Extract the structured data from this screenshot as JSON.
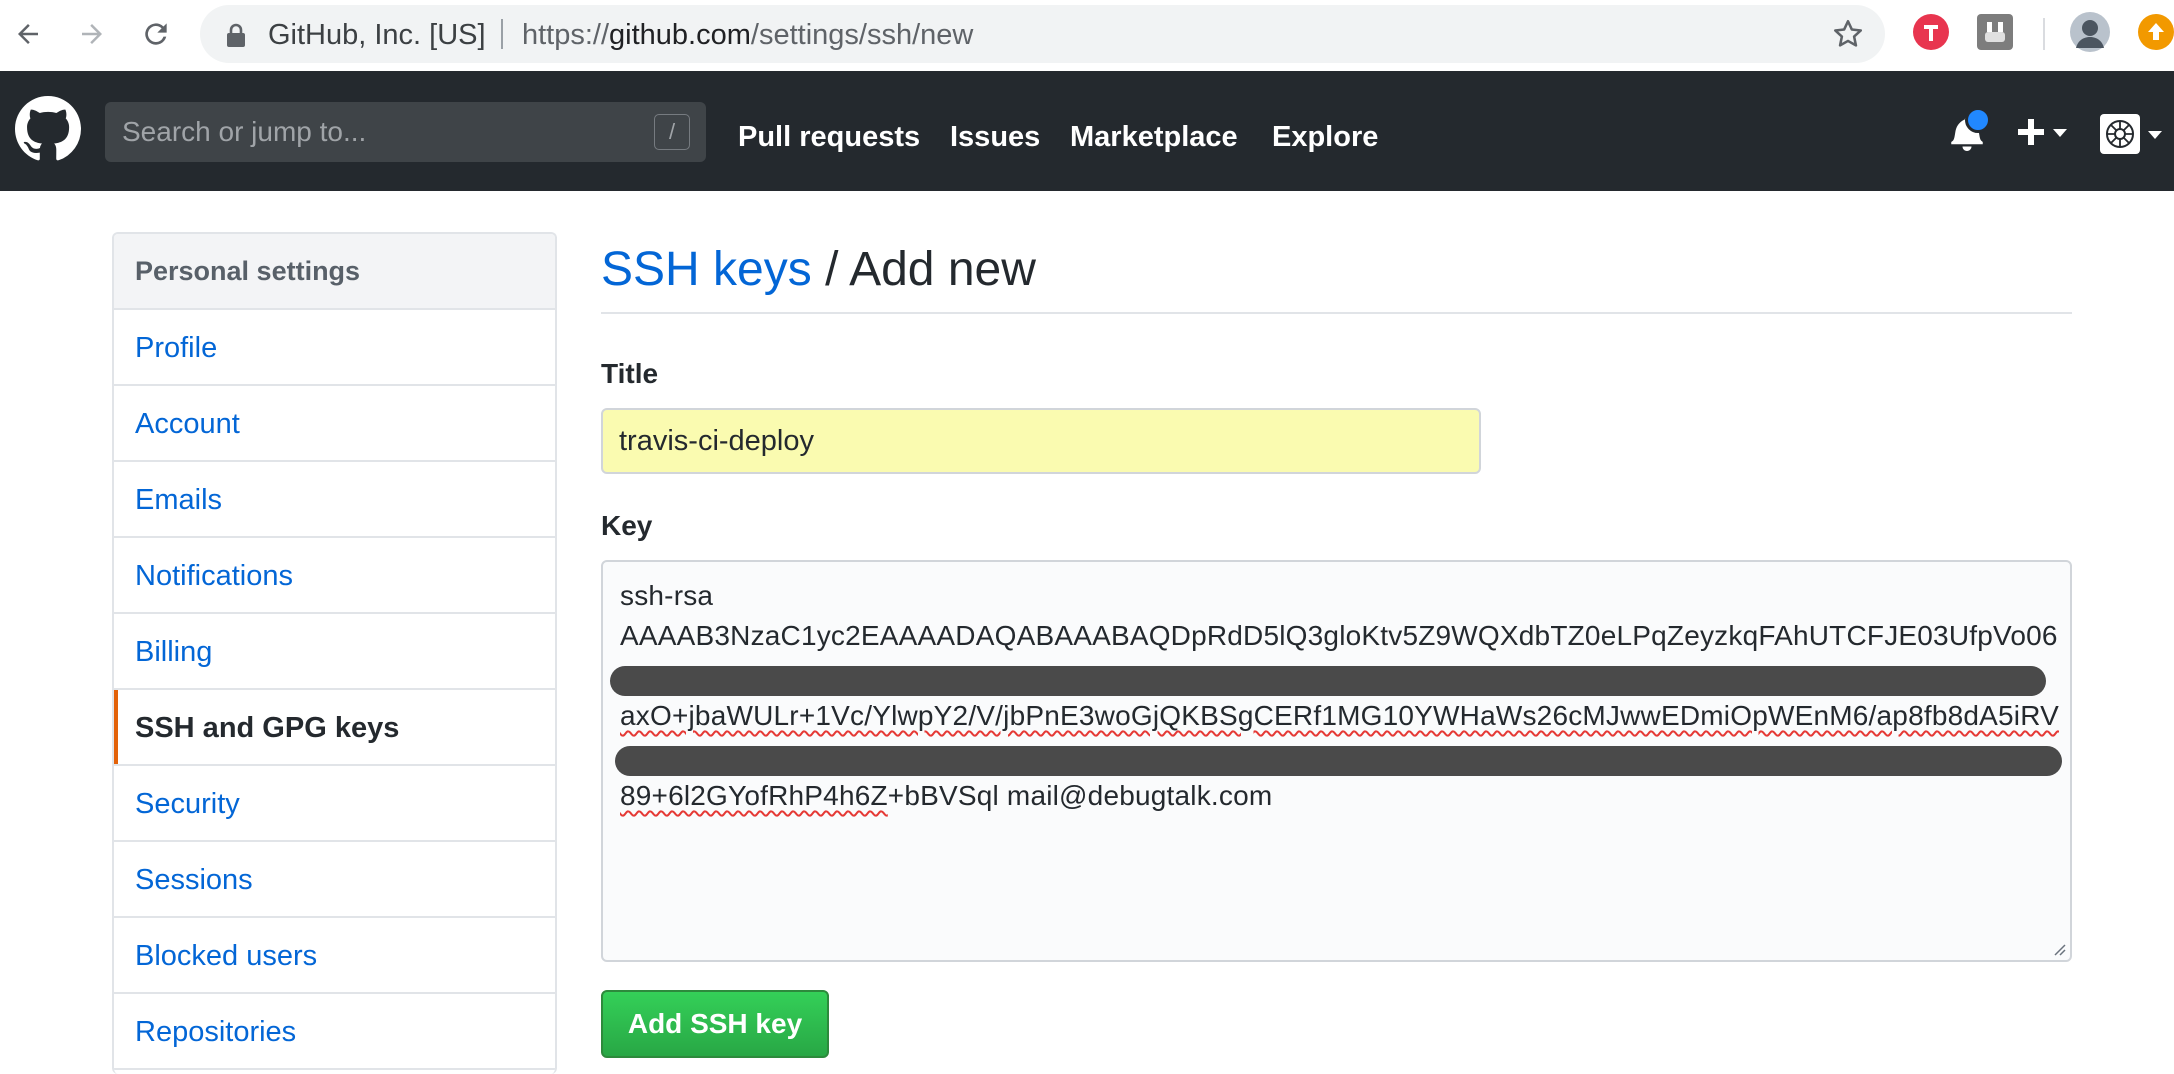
{
  "browser": {
    "site_identity": "GitHub, Inc. [US]",
    "url_prefix": "https://",
    "url_host": "github.com",
    "url_path": "/settings/ssh/new"
  },
  "header": {
    "search_placeholder": "Search or jump to...",
    "search_shortcut": "/",
    "nav": [
      "Pull requests",
      "Issues",
      "Marketplace",
      "Explore"
    ],
    "notification_dot_color": "#2188ff",
    "background_color": "#24292e"
  },
  "sidebar": {
    "heading": "Personal settings",
    "items": [
      {
        "label": "Profile"
      },
      {
        "label": "Account"
      },
      {
        "label": "Emails"
      },
      {
        "label": "Notifications"
      },
      {
        "label": "Billing"
      },
      {
        "label": "SSH and GPG keys",
        "selected": true
      },
      {
        "label": "Security"
      },
      {
        "label": "Sessions"
      },
      {
        "label": "Blocked users"
      },
      {
        "label": "Repositories"
      }
    ],
    "selected_accent_color": "#e36209"
  },
  "main": {
    "breadcrumb_link": "SSH keys",
    "breadcrumb_rest": " / Add new",
    "title_label": "Title",
    "title_value": "travis-ci-deploy",
    "key_label": "Key",
    "key_lines": {
      "line1": "ssh-rsa",
      "line2": "AAAAB3NzaC1yc2EAAAADAQABAAABAQDpRdD5lQ3gloKtv5Z9WQXdbTZ0eLPqZeyzkqFAhUTCFJE03UfpVo06",
      "line3": "axO+jbaWULr+1Vc/YlwpY2/V/jbPnE3woGjQKBSgCERf1MG10YWHaWs26cMJwwEDmiOpWEnM6/ap8fb8dA5iRV",
      "line4_underlined": "89+6l2GYofRhP4h6Z",
      "line4_rest": "+bBVSql mail@debugtalk.com"
    },
    "submit_label": "Add SSH key",
    "submit_color": "#28a745",
    "title_input_bg": "#fafbb0"
  }
}
